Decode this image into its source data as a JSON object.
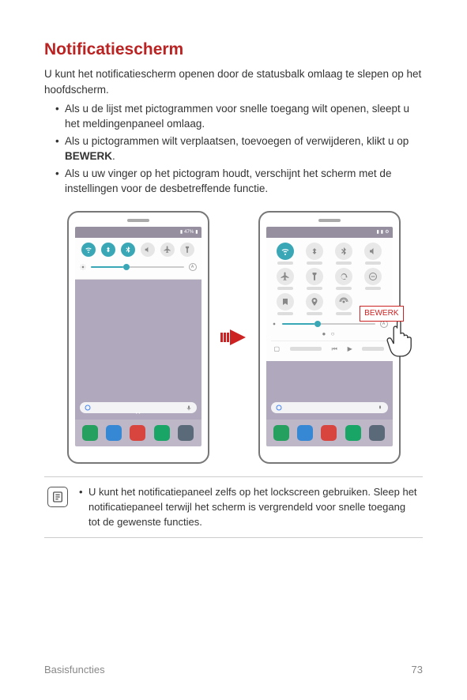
{
  "heading": "Notificatiescherm",
  "intro": "U kunt het notificatiescherm openen door de statusbalk omlaag te slepen op het hoofdscherm.",
  "bullets": [
    {
      "text": "Als u de lijst met pictogrammen voor snelle toegang wilt openen, sleept u het meldingenpaneel omlaag."
    },
    {
      "pre": "Als u pictogrammen wilt verplaatsen, toevoegen of verwijderen, klikt u op ",
      "bold": "BEWERK",
      "post": "."
    },
    {
      "text": "Als u uw vinger op het pictogram houdt, verschijnt het scherm met de instellingen voor de desbetreffende functie."
    }
  ],
  "status_pct": "47%",
  "edit_label": "BEWERK",
  "note": "U kunt het notificatiepaneel zelfs op het lockscreen gebruiken. Sleep het notificatiepaneel terwijl het scherm is vergrendeld voor snelle toegang tot de gewenste functies.",
  "footer_left": "Basisfuncties",
  "footer_right": "73"
}
